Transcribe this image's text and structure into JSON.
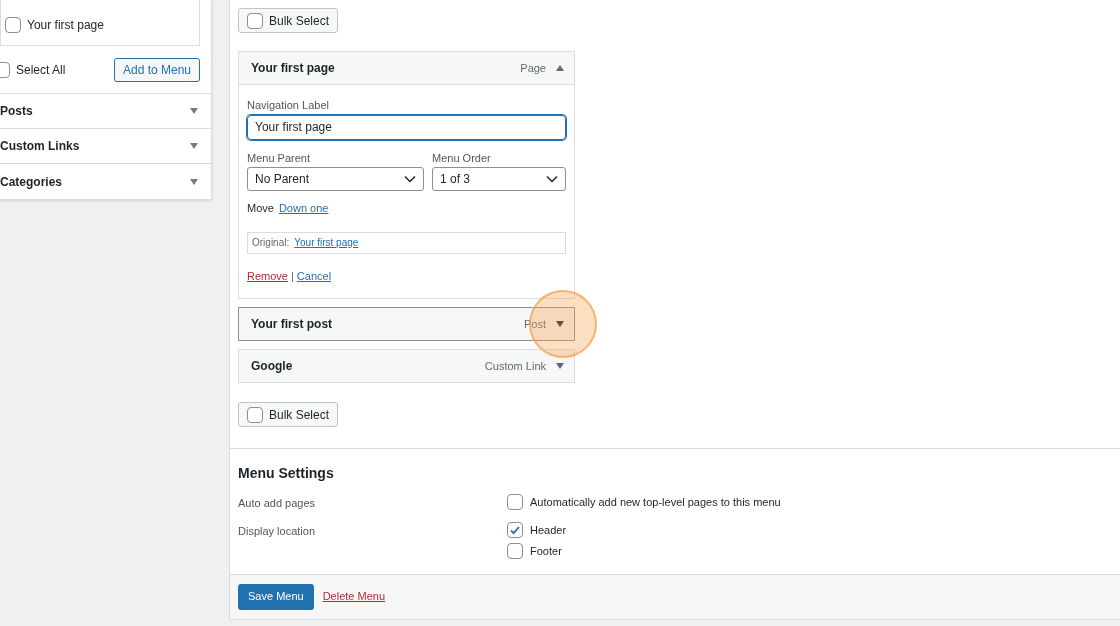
{
  "sidebar": {
    "items": [
      {
        "label": "Your first page",
        "checked": false
      }
    ],
    "select_all": {
      "label": "Select All",
      "checked": false
    },
    "add_button": "Add to Menu",
    "accordions": [
      {
        "title": "Posts",
        "expanded": false
      },
      {
        "title": "Custom Links",
        "expanded": false
      },
      {
        "title": "Categories",
        "expanded": false
      }
    ]
  },
  "bulk_select_top": {
    "label": "Bulk Select",
    "checked": false
  },
  "menu_items": [
    {
      "title": "Your first page",
      "type": "Page",
      "expanded": true,
      "hovered": false,
      "nav_label_label": "Navigation Label",
      "nav_label_value": "Your first page",
      "parent_label": "Menu Parent",
      "parent_value": "No Parent",
      "order_label": "Menu Order",
      "order_value": "1 of 3",
      "move_label": "Move",
      "move_link": "Down one",
      "original_label": "Original:",
      "original_link": "Your first page",
      "remove": "Remove",
      "separator": "|",
      "cancel": "Cancel"
    },
    {
      "title": "Your first post",
      "type": "Post",
      "expanded": false,
      "hovered": true
    },
    {
      "title": "Google",
      "type": "Custom Link",
      "expanded": false,
      "hovered": false
    }
  ],
  "bulk_select_bottom": {
    "label": "Bulk Select",
    "checked": false
  },
  "menu_settings": {
    "heading": "Menu Settings",
    "rows": [
      {
        "label": "Auto add pages",
        "options": [
          {
            "label": "Automatically add new top-level pages to this menu",
            "checked": false
          }
        ]
      },
      {
        "label": "Display location",
        "options": [
          {
            "label": "Header",
            "checked": true
          },
          {
            "label": "Footer",
            "checked": false
          }
        ]
      }
    ]
  },
  "footer": {
    "save": "Save Menu",
    "delete": "Delete Menu"
  }
}
